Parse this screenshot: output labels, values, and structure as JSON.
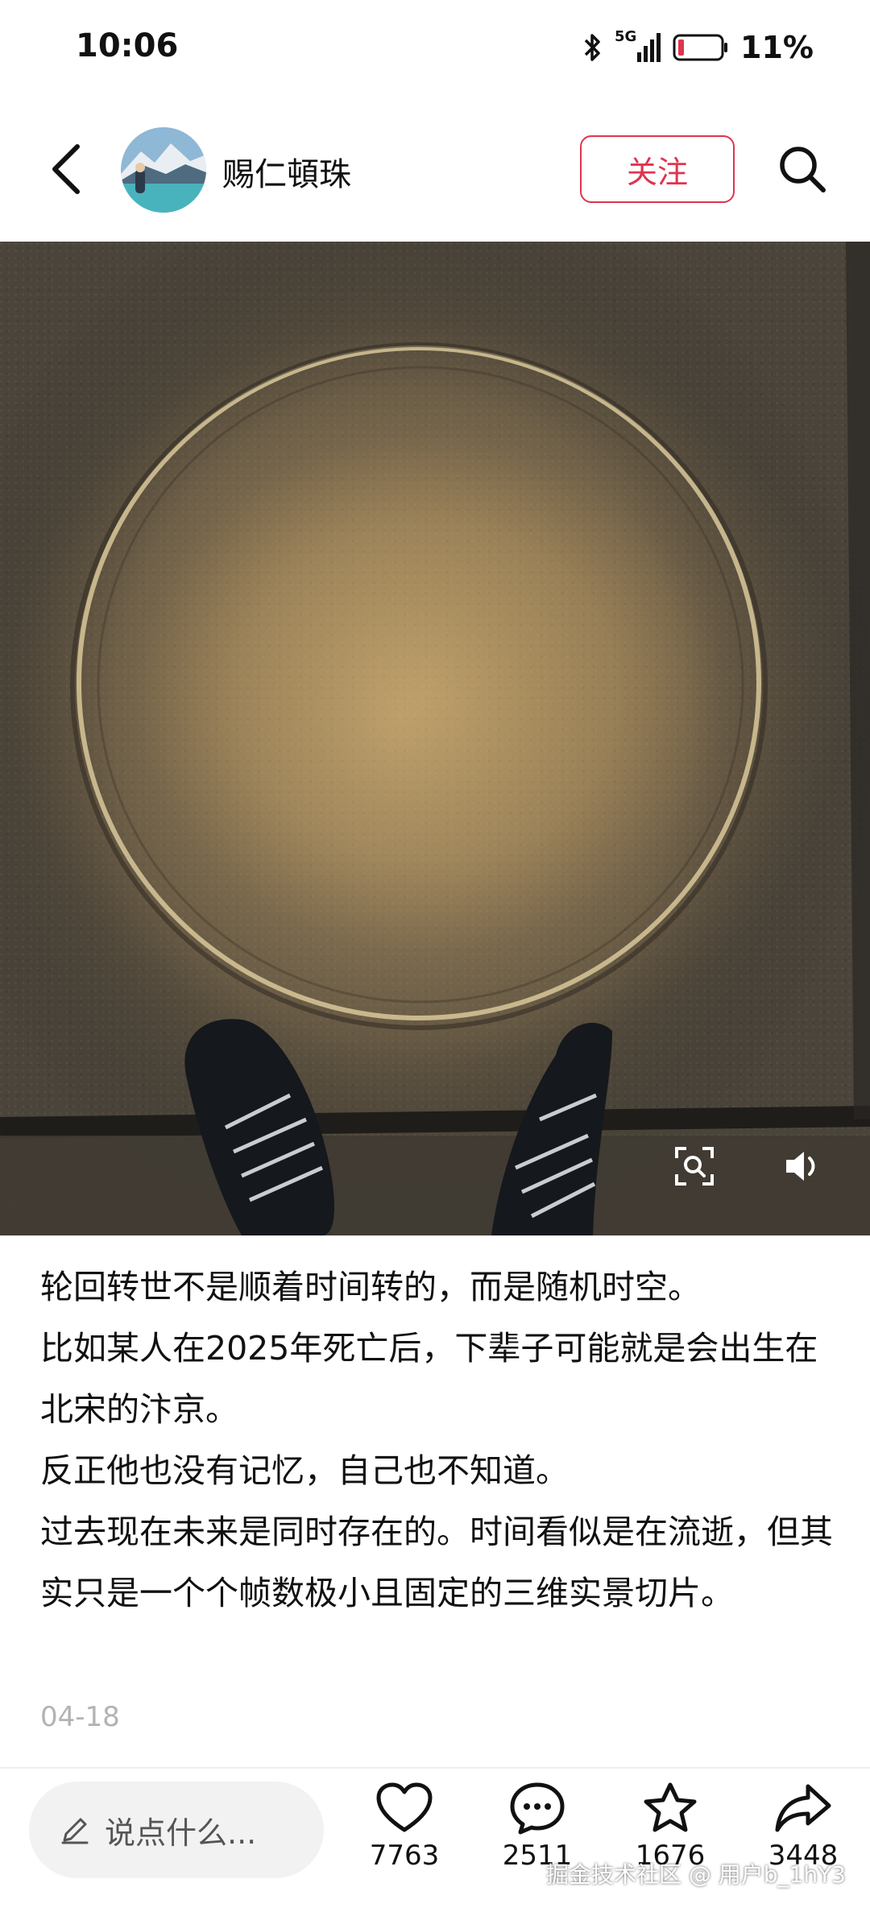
{
  "status_bar": {
    "time": "10:06",
    "network": "5G",
    "battery_text": "11%"
  },
  "header": {
    "username": "赐仁頓珠",
    "follow_label": "关注"
  },
  "post": {
    "text": "轮回转世不是顺着时间转的，而是随机时空。\n比如某人在2025年死亡后，下辈子可能就是会出生在北宋的汴京。\n反正他也没有记忆，自己也不知道。\n过去现在未来是同时存在的。时间看似是在流逝，但其实只是一个个帧数极小且固定的三维实景切片。",
    "date": "04-18"
  },
  "bottom_bar": {
    "comment_placeholder": "说点什么...",
    "like_count": "7763",
    "comment_count": "2511",
    "favorite_count": "1676",
    "share_count": "3448"
  },
  "watermark": "掘金技术社区 @ 用户b_1hY3",
  "colors": {
    "accent": "#e0344f",
    "date_gray": "#b3b3b3",
    "input_bg": "#f2f2f2"
  }
}
